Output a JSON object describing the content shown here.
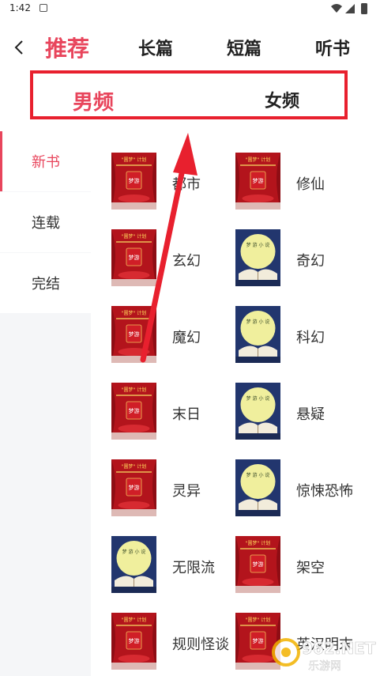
{
  "status_bar": {
    "time": "1:42"
  },
  "top_nav": {
    "tabs": [
      {
        "label": "推荐",
        "active": true
      },
      {
        "label": "长篇",
        "active": false
      },
      {
        "label": "短篇",
        "active": false
      },
      {
        "label": "听书",
        "active": false
      }
    ]
  },
  "gender_tabs": [
    {
      "label": "男频",
      "active": true
    },
    {
      "label": "女频",
      "active": false
    }
  ],
  "sidebar": {
    "items": [
      {
        "label": "新书",
        "active": true
      },
      {
        "label": "连载",
        "active": false
      },
      {
        "label": "完结",
        "active": false
      }
    ]
  },
  "genres": [
    {
      "label": "都市",
      "cover": "red-stage"
    },
    {
      "label": "修仙",
      "cover": "red-stage"
    },
    {
      "label": "玄幻",
      "cover": "red-stage"
    },
    {
      "label": "奇幻",
      "cover": "moon-book"
    },
    {
      "label": "魔幻",
      "cover": "red-stage"
    },
    {
      "label": "科幻",
      "cover": "moon-book"
    },
    {
      "label": "末日",
      "cover": "red-stage"
    },
    {
      "label": "悬疑",
      "cover": "moon-book"
    },
    {
      "label": "灵异",
      "cover": "red-stage"
    },
    {
      "label": "惊悚恐怖",
      "cover": "moon-book"
    },
    {
      "label": "无限流",
      "cover": "moon-book"
    },
    {
      "label": "架空",
      "cover": "red-stage"
    },
    {
      "label": "规则怪谈",
      "cover": "red-stage"
    },
    {
      "label": "英汉明末",
      "cover": "red-stage"
    }
  ],
  "covers": {
    "red-stage": {
      "text_top": "\"圆梦\" 计划",
      "text_center": "梦游"
    },
    "moon-book": {
      "text_center": "梦 游 小 说"
    }
  },
  "watermark": {
    "text": "962.NET",
    "sub": "乐游网"
  },
  "colors": {
    "accent": "#e8455c",
    "annotation": "#e8202e"
  }
}
